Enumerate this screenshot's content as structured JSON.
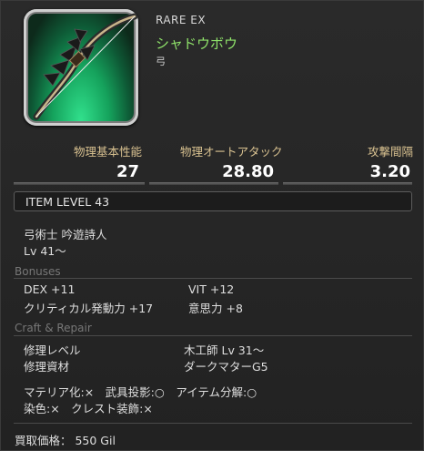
{
  "item": {
    "rarity": "RARE  EX",
    "name": "シャドウボウ",
    "type": "弓"
  },
  "stats": [
    {
      "label": "物理基本性能",
      "value": "27"
    },
    {
      "label": "物理オートアタック",
      "value": "28.80"
    },
    {
      "label": "攻撃間隔",
      "value": "3.20"
    }
  ],
  "item_level": "ITEM LEVEL 43",
  "requirements": {
    "classes": "弓術士 吟遊詩人",
    "level": "Lv 41～"
  },
  "bonuses": {
    "title": "Bonuses",
    "entries": [
      {
        "text": "DEX +11"
      },
      {
        "text": "VIT +12"
      },
      {
        "text": "クリティカル発動力 +17"
      },
      {
        "text": "意思力 +8"
      }
    ]
  },
  "craft": {
    "title": "Craft & Repair",
    "repair_level_label": "修理レベル",
    "repair_level_value": "木工師 Lv 31～",
    "repair_material_label": "修理資材",
    "repair_material_value": "ダークマターG5",
    "flags_line1": "マテリア化:×　武具投影:○　アイテム分解:○",
    "flags_line2": "染色:×　クレスト装飾:×"
  },
  "sell_price": "買取価格：  550 Gil",
  "colors": {
    "name_green": "#8fe36a",
    "stat_label_gold": "#d8c190",
    "icon_glow": "#31e08c"
  },
  "icons": [
    "bow-icon"
  ]
}
